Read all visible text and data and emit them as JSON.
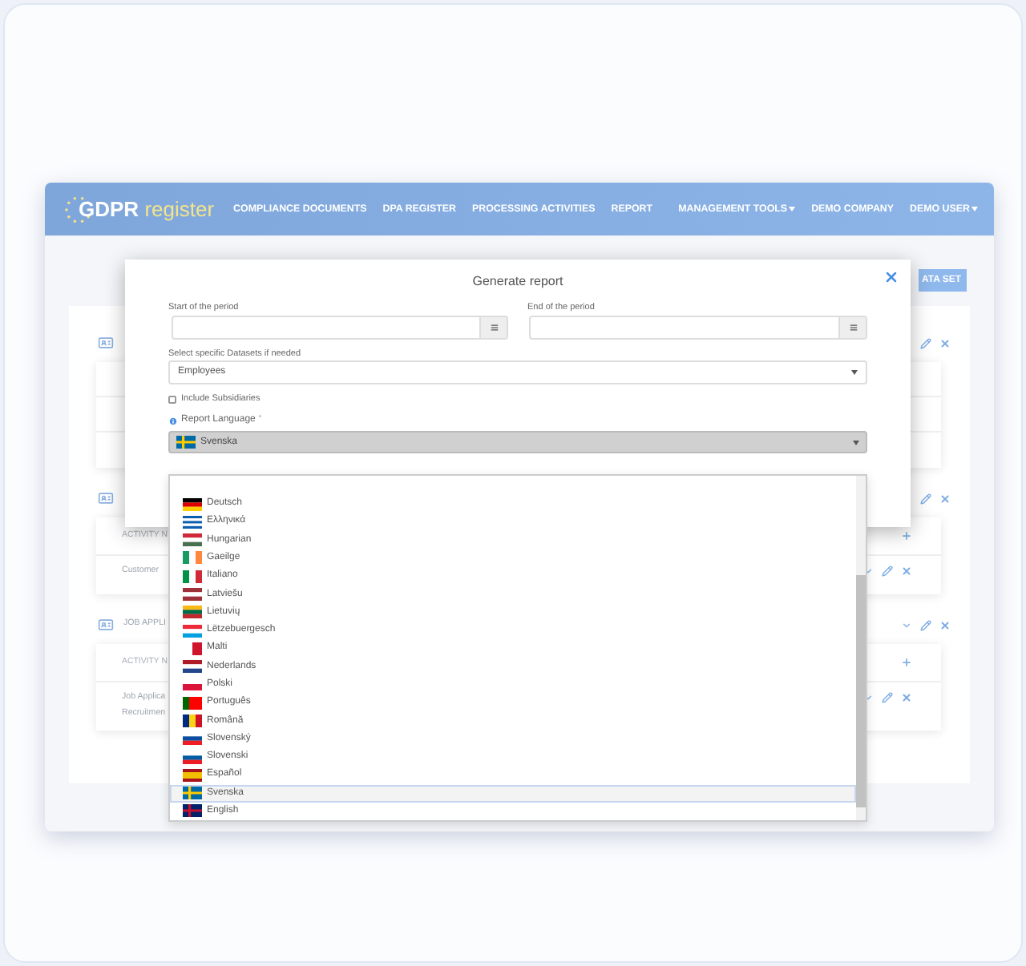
{
  "navbar": {
    "logo_primary": "GDPR",
    "logo_secondary": "register",
    "left_links": [
      {
        "label": "COMPLIANCE DOCUMENTS",
        "dropdown": false
      },
      {
        "label": "DPA REGISTER",
        "dropdown": false
      },
      {
        "label": "PROCESSING ACTIVITIES",
        "dropdown": false
      },
      {
        "label": "REPORT",
        "dropdown": false
      }
    ],
    "right_links": [
      {
        "label": "MANAGEMENT TOOLS",
        "dropdown": true
      },
      {
        "label": "DEMO COMPANY",
        "dropdown": false
      },
      {
        "label": "DEMO USER",
        "dropdown": true
      }
    ]
  },
  "page": {
    "add_button": "ATA SET",
    "sections": [
      {
        "actions": [
          {
            "kind": "edit"
          },
          {
            "kind": "delete"
          }
        ],
        "rows": [
          {
            "kind": "blank"
          },
          {
            "kind": "blank"
          },
          {
            "kind": "blank"
          }
        ]
      },
      {
        "actions": [
          {
            "kind": "edit"
          },
          {
            "kind": "delete"
          }
        ],
        "header_row": "ACTIVITY N",
        "rows": [
          {
            "kind": "activity",
            "lines": [
              "Customer"
            ],
            "actions": [
              {
                "kind": "expand"
              },
              {
                "kind": "edit"
              },
              {
                "kind": "delete"
              }
            ]
          }
        ]
      },
      {
        "title": "JOB APPLI",
        "actions": [
          {
            "kind": "expand"
          },
          {
            "kind": "edit"
          },
          {
            "kind": "delete"
          }
        ],
        "header_row": "ACTIVITY N",
        "rows": [
          {
            "kind": "activity",
            "lines": [
              "Job Applica",
              "Recruitmen"
            ],
            "actions": [
              {
                "kind": "expand"
              },
              {
                "kind": "edit"
              },
              {
                "kind": "delete"
              }
            ]
          }
        ]
      }
    ]
  },
  "modal": {
    "title": "Generate report",
    "start_label": "Start of the period",
    "end_label": "End of the period",
    "datasets_label": "Select specific Datasets if needed",
    "datasets_value": "Employees",
    "subsidiaries": {
      "label": "Include Subsidiaries",
      "checked": false
    },
    "language_label": "Report Language",
    "required_mark": "*",
    "language_value": {
      "label": "Svenska",
      "flag": {
        "kind": "cross",
        "stripes": [
          {
            "color": "#006aa7"
          },
          {
            "color": "#fecc00"
          }
        ]
      }
    },
    "languages": [
      {
        "label": "Deutsch",
        "selected": false,
        "flag": {
          "kind": "horizontal",
          "stripes": [
            {
              "color": "#000000"
            },
            {
              "color": "#dd0000"
            },
            {
              "color": "#ffce00"
            }
          ]
        }
      },
      {
        "label": "Ελληνικά",
        "selected": false,
        "flag": {
          "kind": "horizontal",
          "stripes": [
            {
              "color": "#0d5eaf"
            },
            {
              "color": "#ffffff"
            },
            {
              "color": "#0d5eaf"
            },
            {
              "color": "#ffffff"
            },
            {
              "color": "#0d5eaf"
            }
          ]
        }
      },
      {
        "label": "Hungarian",
        "selected": false,
        "flag": {
          "kind": "horizontal",
          "stripes": [
            {
              "color": "#ce2939"
            },
            {
              "color": "#ffffff"
            },
            {
              "color": "#477050"
            }
          ]
        }
      },
      {
        "label": "Gaeilge",
        "selected": false,
        "flag": {
          "kind": "vertical",
          "stripes": [
            {
              "color": "#169b62"
            },
            {
              "color": "#ffffff"
            },
            {
              "color": "#ff883e"
            }
          ]
        }
      },
      {
        "label": "Italiano",
        "selected": false,
        "flag": {
          "kind": "vertical",
          "stripes": [
            {
              "color": "#009246"
            },
            {
              "color": "#ffffff"
            },
            {
              "color": "#ce2b37"
            }
          ]
        }
      },
      {
        "label": "Latviešu",
        "selected": false,
        "flag": {
          "kind": "horizontal",
          "stripes": [
            {
              "color": "#9e3039"
            },
            {
              "color": "#ffffff"
            },
            {
              "color": "#9e3039"
            }
          ]
        }
      },
      {
        "label": "Lietuvių",
        "selected": false,
        "flag": {
          "kind": "horizontal",
          "stripes": [
            {
              "color": "#fdb913"
            },
            {
              "color": "#006a44"
            },
            {
              "color": "#c1272d"
            }
          ]
        }
      },
      {
        "label": "Lëtzebuergesch",
        "selected": false,
        "flag": {
          "kind": "horizontal",
          "stripes": [
            {
              "color": "#ed2939"
            },
            {
              "color": "#ffffff"
            },
            {
              "color": "#00a1de"
            }
          ]
        }
      },
      {
        "label": "Malti",
        "selected": false,
        "flag": {
          "kind": "vertical",
          "stripes": [
            {
              "color": "#ffffff"
            },
            {
              "color": "#cf142b"
            }
          ]
        }
      },
      {
        "label": "Nederlands",
        "selected": false,
        "flag": {
          "kind": "horizontal",
          "stripes": [
            {
              "color": "#ae1c28"
            },
            {
              "color": "#ffffff"
            },
            {
              "color": "#21468b"
            }
          ]
        }
      },
      {
        "label": "Polski",
        "selected": false,
        "flag": {
          "kind": "horizontal",
          "stripes": [
            {
              "color": "#ffffff"
            },
            {
              "color": "#dc143c"
            }
          ]
        }
      },
      {
        "label": "Português",
        "selected": false,
        "flag": {
          "kind": "vertical",
          "stripes": [
            {
              "color": "#006600"
            },
            {
              "color": "#ff0000"
            },
            {
              "color": "#ff0000"
            }
          ]
        }
      },
      {
        "label": "Română",
        "selected": false,
        "flag": {
          "kind": "vertical",
          "stripes": [
            {
              "color": "#002b7f"
            },
            {
              "color": "#fcd116"
            },
            {
              "color": "#ce1126"
            }
          ]
        }
      },
      {
        "label": "Slovenský",
        "selected": false,
        "flag": {
          "kind": "horizontal",
          "stripes": [
            {
              "color": "#ffffff"
            },
            {
              "color": "#0b4ea2"
            },
            {
              "color": "#ee1c25"
            }
          ]
        }
      },
      {
        "label": "Slovenski",
        "selected": false,
        "flag": {
          "kind": "horizontal",
          "stripes": [
            {
              "color": "#ffffff"
            },
            {
              "color": "#005da4"
            },
            {
              "color": "#ed1c24"
            }
          ]
        }
      },
      {
        "label": "Español",
        "selected": false,
        "flag": {
          "kind": "horizontal",
          "stripes": [
            {
              "color": "#aa151b"
            },
            {
              "color": "#f1bf00"
            },
            {
              "color": "#f1bf00"
            },
            {
              "color": "#aa151b"
            }
          ]
        }
      },
      {
        "label": "Svenska",
        "selected": true,
        "flag": {
          "kind": "cross",
          "stripes": [
            {
              "color": "#006aa7"
            },
            {
              "color": "#fecc00"
            }
          ]
        }
      },
      {
        "label": "English",
        "selected": false,
        "flag": {
          "kind": "cross",
          "stripes": [
            {
              "color": "#012169"
            },
            {
              "color": "#c8102e"
            }
          ]
        }
      }
    ]
  }
}
